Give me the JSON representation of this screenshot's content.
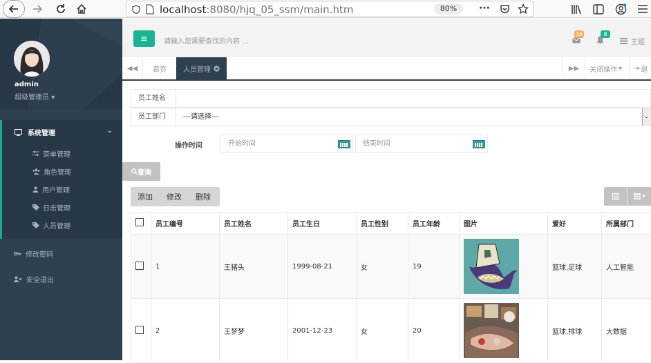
{
  "browser": {
    "url_host": "localhost",
    "url_rest": ":8080/hjq_05_ssm/main.htm",
    "zoom": "80%"
  },
  "sidebar": {
    "username": "admin",
    "role": "超级管理员",
    "menu_title": "系统管理",
    "sub_items": [
      {
        "label": "菜单管理",
        "icon": "sliders-icon"
      },
      {
        "label": "角色管理",
        "icon": "users-icon"
      },
      {
        "label": "用户管理",
        "icon": "user-icon"
      },
      {
        "label": "日志管理",
        "icon": "tag-icon"
      },
      {
        "label": "人员管理",
        "icon": "tag-icon"
      }
    ],
    "change_password": "修改密码",
    "logout": "安全退出"
  },
  "topbar": {
    "search_placeholder": "请输入您需要查找的内容 ...",
    "mail_count": "16",
    "bell_count": "8",
    "theme_label": "主题"
  },
  "tabs": {
    "home": "首页",
    "active": "人员管理",
    "close_ops": "关闭操作",
    "exit": "退"
  },
  "form": {
    "name_label": "员工姓名",
    "name_value": "",
    "dept_label": "员工部门",
    "dept_value": "---请选择---",
    "time_label": "操作时间",
    "start_placeholder": "开始时间",
    "end_placeholder": "结束时间",
    "query_label": "查询"
  },
  "toolbar": {
    "add": "添加",
    "edit": "修改",
    "delete": "删除"
  },
  "table": {
    "headers": [
      "员工编号",
      "员工姓名",
      "员工生日",
      "员工性别",
      "员工年龄",
      "图片",
      "爱好",
      "所属部门"
    ],
    "rows": [
      {
        "id": "1",
        "name": "王猪头",
        "birthday": "1999-08-21",
        "gender": "女",
        "age": "19",
        "hobby": "篮球,足球",
        "dept": "人工智能"
      },
      {
        "id": "2",
        "name": "王梦梦",
        "birthday": "2001-12-23",
        "gender": "女",
        "age": "20",
        "hobby": "篮球,排球",
        "dept": "大数据"
      }
    ]
  },
  "colors": {
    "sidebar_bg": "#2f4050",
    "accent": "#1ab394",
    "mail_badge": "#f8ac59",
    "bell_badge": "#1ab394"
  }
}
